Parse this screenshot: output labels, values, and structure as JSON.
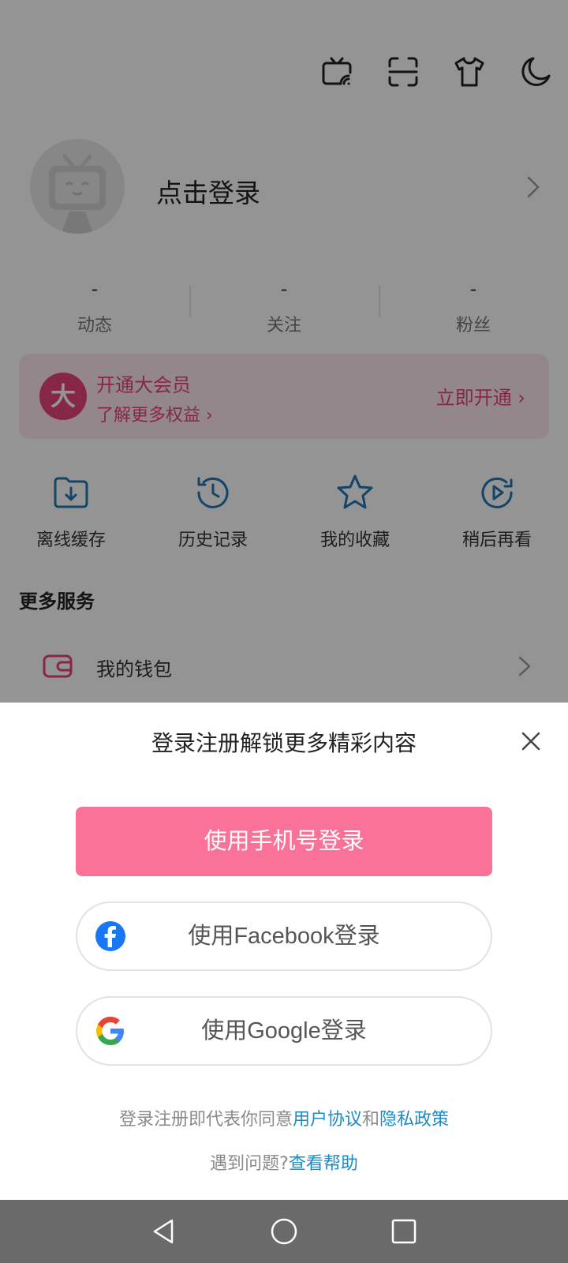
{
  "profile": {
    "login_label": "点击登录",
    "stats": [
      {
        "value": "-",
        "label": "动态"
      },
      {
        "value": "-",
        "label": "关注"
      },
      {
        "value": "-",
        "label": "粉丝"
      }
    ]
  },
  "vip": {
    "badge": "大",
    "title": "开通大会员",
    "subtitle": "了解更多权益 ›",
    "action": "立即开通 ›"
  },
  "quick_actions": [
    {
      "label": "离线缓存",
      "icon": "download-folder-icon"
    },
    {
      "label": "历史记录",
      "icon": "history-clock-icon"
    },
    {
      "label": "我的收藏",
      "icon": "star-icon"
    },
    {
      "label": "稍后再看",
      "icon": "watch-later-icon"
    }
  ],
  "more_services": {
    "title": "更多服务",
    "wallet_label": "我的钱包"
  },
  "login_sheet": {
    "title": "登录注册解锁更多精彩内容",
    "phone_button": "使用手机号登录",
    "facebook_button": "使用Facebook登录",
    "google_button": "使用Google登录",
    "agreement_prefix": "登录注册即代表你同意",
    "user_agreement_link": "用户协议",
    "and_text": "和",
    "privacy_link": "隐私政策",
    "help_prefix": "遇到问题?",
    "help_link": "查看帮助"
  },
  "colors": {
    "brand_pink": "#fb7299",
    "link_blue": "#1d8cc6",
    "icon_blue": "#1f78b4",
    "vip_pink": "#e8447a"
  }
}
